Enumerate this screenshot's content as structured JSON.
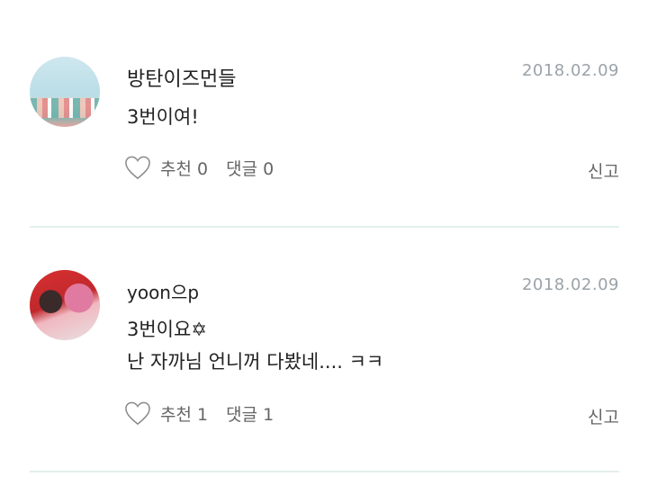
{
  "comments": [
    {
      "author": "방탄이즈먼들",
      "date": "2018.02.09",
      "lines": [
        "3번이여!"
      ],
      "like_label": "추천 0",
      "reply_label": "댓글 0",
      "report_label": "신고"
    },
    {
      "author": "yoon으p",
      "date": "2018.02.09",
      "lines": [
        "3번이요✡",
        "난 자까님 언니꺼 다봤네.... ㅋㅋ"
      ],
      "like_label": "추천 1",
      "reply_label": "댓글 1",
      "report_label": "신고"
    }
  ],
  "colors": {
    "divider": "#e2f0ea",
    "date": "#9aa3a8",
    "icon": "heart-outline-icon"
  }
}
